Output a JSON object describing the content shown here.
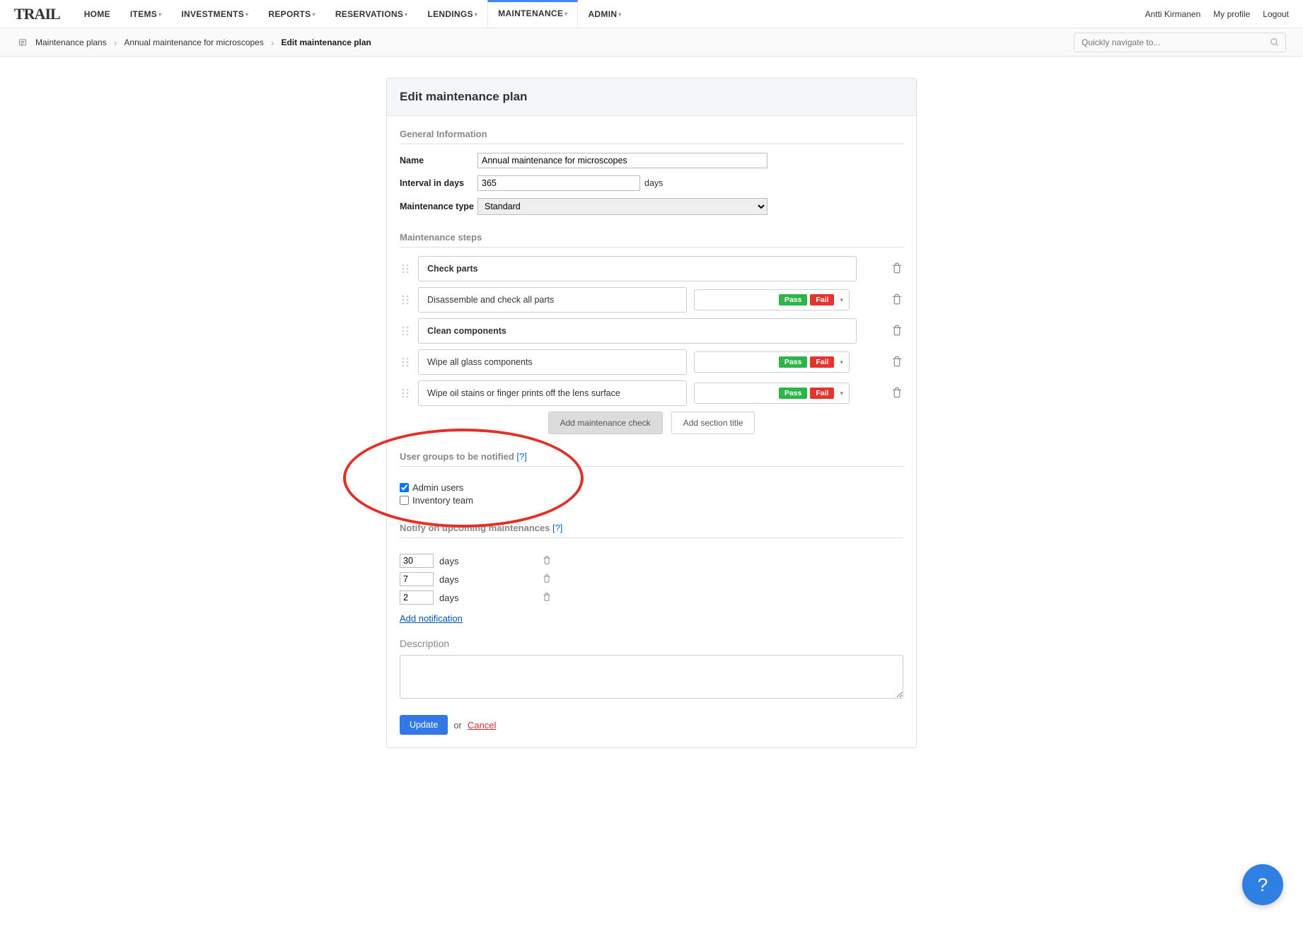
{
  "nav": {
    "logo": "TRAIL",
    "items": [
      {
        "label": "HOME",
        "dropdown": false
      },
      {
        "label": "ITEMS",
        "dropdown": true
      },
      {
        "label": "INVESTMENTS",
        "dropdown": true
      },
      {
        "label": "REPORTS",
        "dropdown": true
      },
      {
        "label": "RESERVATIONS",
        "dropdown": true
      },
      {
        "label": "LENDINGS",
        "dropdown": true
      },
      {
        "label": "MAINTENANCE",
        "dropdown": true,
        "active": true
      },
      {
        "label": "ADMIN",
        "dropdown": true
      }
    ],
    "right": {
      "username": "Antti Kirmanen",
      "profile": "My profile",
      "logout": "Logout"
    }
  },
  "breadcrumbs": {
    "items": [
      {
        "label": "Maintenance plans"
      },
      {
        "label": "Annual maintenance for microscopes"
      },
      {
        "label": "Edit maintenance plan",
        "current": true
      }
    ],
    "search_placeholder": "Quickly navigate to..."
  },
  "page": {
    "title": "Edit maintenance plan",
    "sections": {
      "general": {
        "title": "General Information",
        "name_label": "Name",
        "name_value": "Annual maintenance for microscopes",
        "interval_label": "Interval in days",
        "interval_value": "365",
        "interval_unit": "days",
        "type_label": "Maintenance type",
        "type_value": "Standard"
      },
      "steps": {
        "title": "Maintenance steps",
        "pass_label": "Pass",
        "fail_label": "Fail",
        "rows": [
          {
            "label": "Check parts",
            "type": "section"
          },
          {
            "label": "Disassemble and check all parts",
            "type": "check"
          },
          {
            "label": "Clean components",
            "type": "section"
          },
          {
            "label": "Wipe all glass components",
            "type": "check"
          },
          {
            "label": "Wipe oil stains or finger prints off the lens surface",
            "type": "check"
          }
        ],
        "add_check_btn": "Add maintenance check",
        "add_section_btn": "Add section title"
      },
      "user_groups": {
        "title": "User groups to be notified ",
        "help": "[?]",
        "items": [
          {
            "label": "Admin users",
            "checked": true
          },
          {
            "label": "Inventory team",
            "checked": false
          }
        ]
      },
      "notify": {
        "title": "Notify on upcoming maintenances ",
        "help": "[?]",
        "unit": "days",
        "rows": [
          {
            "value": "30"
          },
          {
            "value": "7"
          },
          {
            "value": "2"
          }
        ],
        "add_link": "Add notification"
      },
      "description": {
        "label": "Description",
        "value": ""
      },
      "footer": {
        "update": "Update",
        "or": "or",
        "cancel": "Cancel"
      }
    }
  },
  "help_fab": "?"
}
